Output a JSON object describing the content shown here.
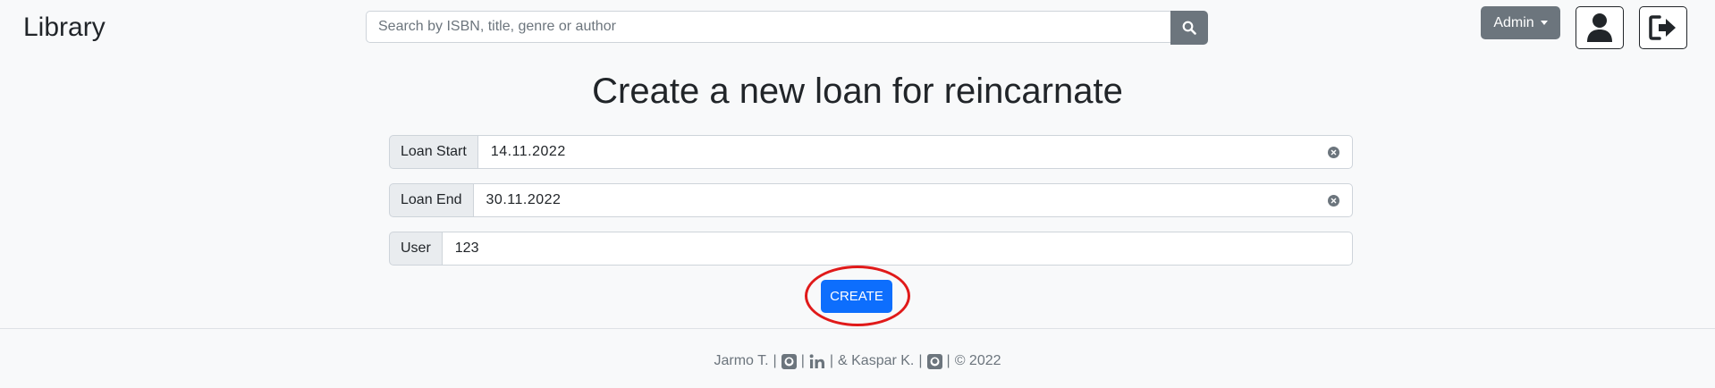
{
  "header": {
    "brand": "Library",
    "search_placeholder": "Search by ISBN, title, genre or author",
    "admin_label": "Admin"
  },
  "page": {
    "title": "Create a new loan for reincarnate"
  },
  "form": {
    "loan_start_label": "Loan Start",
    "loan_start_value": "14.11.2022",
    "loan_end_label": "Loan End",
    "loan_end_value": "30.11.2022",
    "user_label": "User",
    "user_value": "123",
    "create_label": "CREATE"
  },
  "footer": {
    "author1": "Jarmo T.",
    "sep": "|",
    "amp": "& Kaspar K.",
    "copyright": "© 2022"
  },
  "icons": {
    "search": "search-icon",
    "user": "user-icon",
    "logout": "logout-icon",
    "clear": "clear-icon",
    "github": "github-icon",
    "linkedin": "linkedin-icon"
  },
  "colors": {
    "primary": "#0d6efd",
    "secondary": "#6c757d",
    "highlight": "#e01a1a"
  }
}
